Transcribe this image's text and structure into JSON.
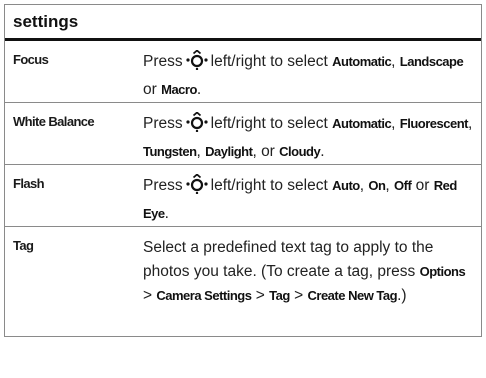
{
  "header": {
    "title": "settings"
  },
  "rows": [
    {
      "name": "Focus",
      "desc": {
        "press": "Press",
        "mid": "left/right to select",
        "opt1": "Automatic",
        "sep1": ",",
        "opt2": "Landscape",
        "sep2": "or",
        "opt3": "Macro",
        "end": "."
      }
    },
    {
      "name": "White Balance",
      "desc": {
        "press": "Press",
        "mid": "left/right to select",
        "opt1": "Automatic",
        "sep1": ",",
        "opt2": "Fluorescent",
        "sep2": ",",
        "opt3": "Tungsten",
        "sep3": ",",
        "opt4": "Daylight",
        "sep4": ", or",
        "opt5": "Cloudy",
        "end": "."
      }
    },
    {
      "name": "Flash",
      "desc": {
        "press": "Press",
        "mid": "left/right to select",
        "opt1": "Auto",
        "sep1": ",",
        "opt2": "On",
        "sep2": ",",
        "opt3": "Off",
        "sep3": "or",
        "opt4": "Red Eye",
        "end": "."
      }
    },
    {
      "name": "Tag",
      "desc": {
        "text1": "Select a predefined text tag to apply to the photos you take. (To create a tag, press",
        "k1": "Options",
        "gt1": ">",
        "k2": "Camera Settings",
        "gt2": ">",
        "k3": "Tag",
        "gt3": ">",
        "k4": "Create New Tag",
        "end": ".)"
      }
    }
  ],
  "icons": {
    "nav_key": "navigation-key-icon"
  }
}
